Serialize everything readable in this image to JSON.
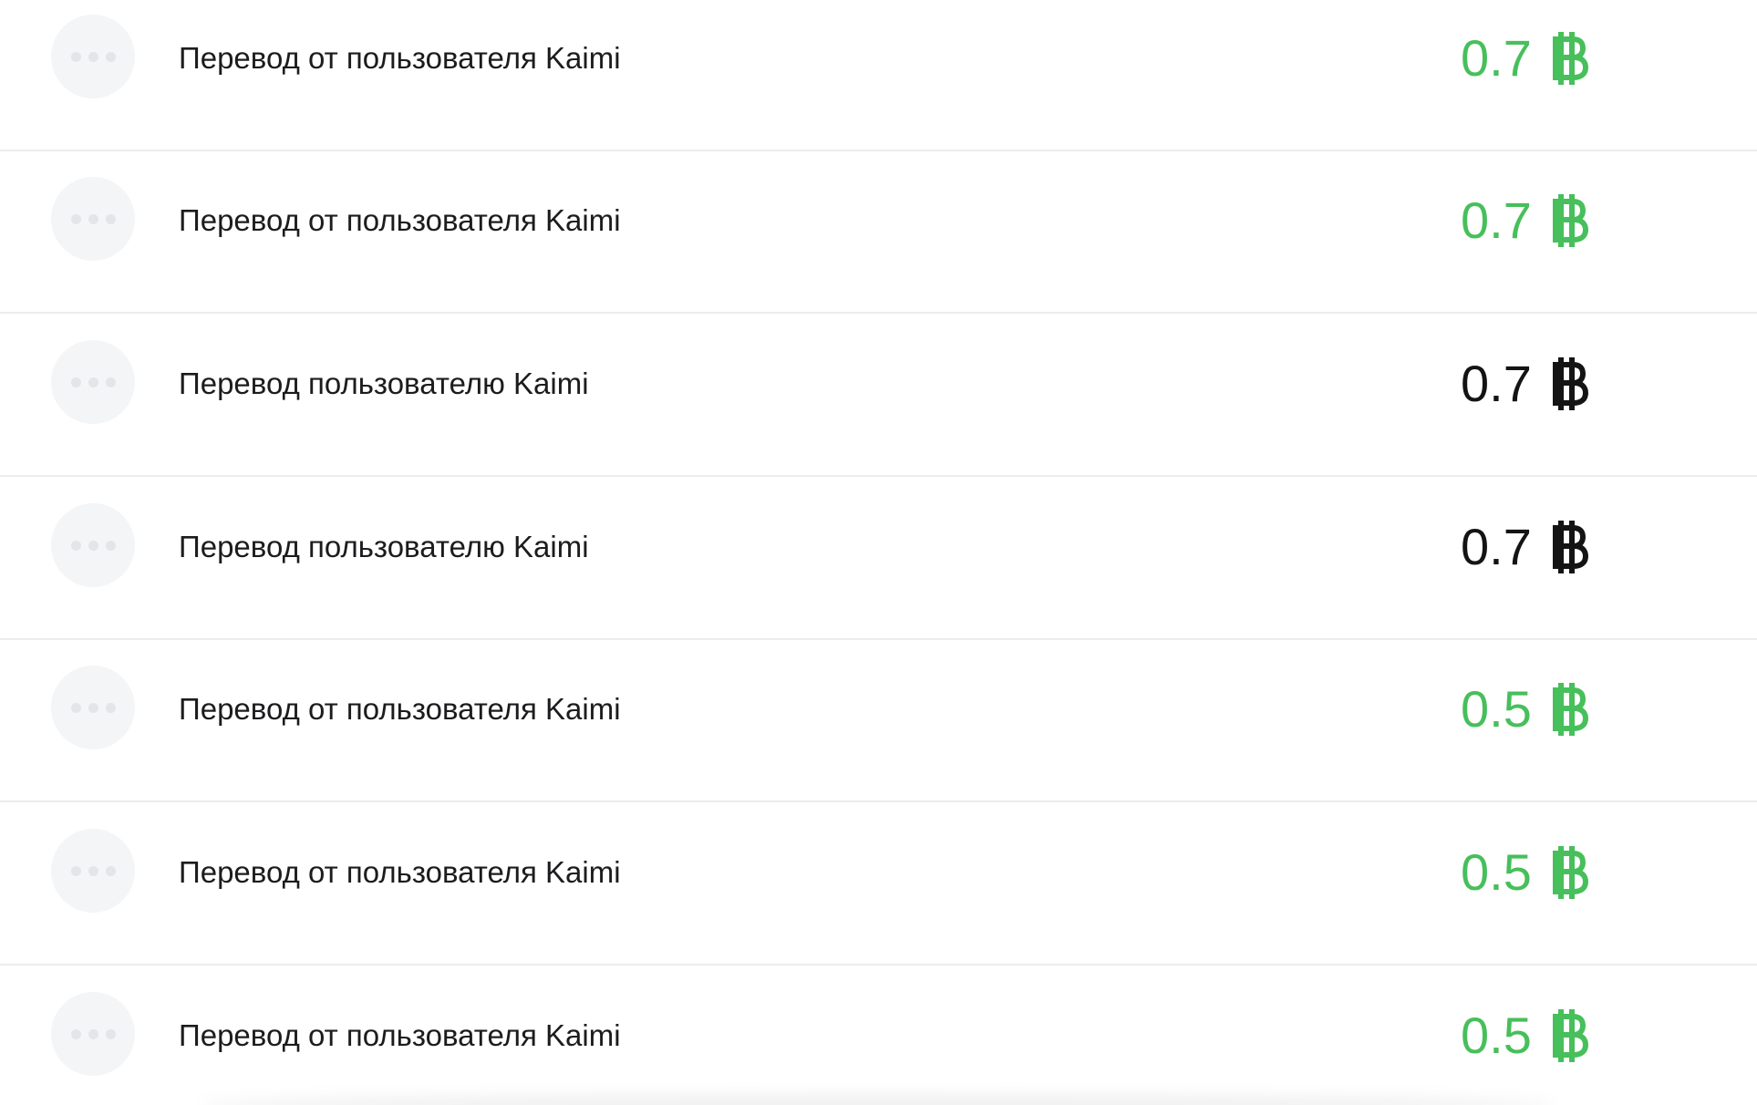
{
  "currency_icon": "bitcoin-icon",
  "colors": {
    "incoming": "#47bf5b",
    "outgoing": "#141414",
    "avatar_bg": "#f4f5f7",
    "divider": "#ececef"
  },
  "transactions": [
    {
      "title": "Перевод от пользователя Kaimi",
      "amount": "0.7",
      "direction": "in"
    },
    {
      "title": "Перевод от пользователя Kaimi",
      "amount": "0.7",
      "direction": "in"
    },
    {
      "title": "Перевод пользователю Kaimi",
      "amount": "0.7",
      "direction": "out"
    },
    {
      "title": "Перевод пользователю Kaimi",
      "amount": "0.7",
      "direction": "out"
    },
    {
      "title": "Перевод от пользователя Kaimi",
      "amount": "0.5",
      "direction": "in"
    },
    {
      "title": "Перевод от пользователя Kaimi",
      "amount": "0.5",
      "direction": "in"
    },
    {
      "title": "Перевод от пользователя Kaimi",
      "amount": "0.5",
      "direction": "in"
    }
  ]
}
